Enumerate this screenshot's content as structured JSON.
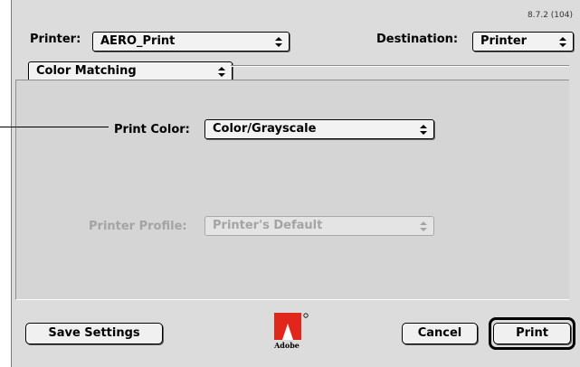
{
  "dialog": {
    "version": "8.7.2 (104)"
  },
  "printer": {
    "label": "Printer:",
    "value": "AERO_Print"
  },
  "destination": {
    "label": "Destination:",
    "value": "Printer"
  },
  "panel_menu": {
    "value": "Color Matching"
  },
  "print_color": {
    "label": "Print Color:",
    "value": "Color/Grayscale"
  },
  "printer_profile": {
    "label": "Printer Profile:",
    "value": "Printer's Default",
    "enabled": false
  },
  "buttons": {
    "save_settings": "Save Settings",
    "cancel": "Cancel",
    "print": "Print"
  },
  "logo": {
    "name": "adobe-logo-icon",
    "text": "Adobe"
  },
  "icons": {
    "popup_arrows": "popup-arrows-icon"
  },
  "colors": {
    "dialog_bg": "#dcdcdc",
    "disabled_text": "#a4a4a4",
    "logo_red": "#e1261c"
  }
}
